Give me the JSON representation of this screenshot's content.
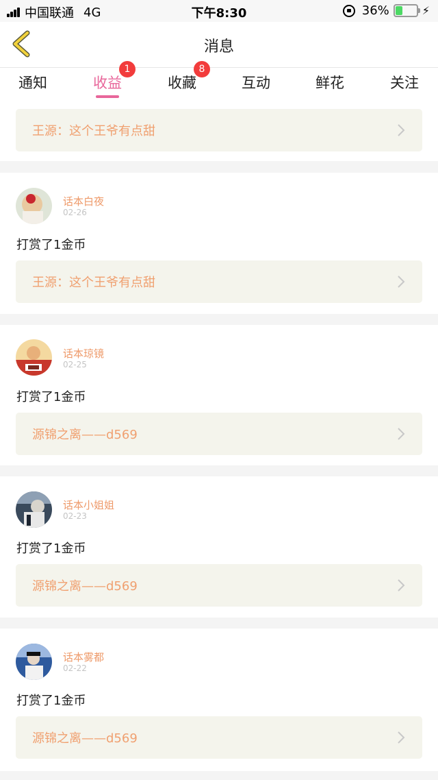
{
  "status_bar": {
    "carrier": "中国联通",
    "network": "4G",
    "time": "下午8:30",
    "battery": "36%",
    "battery_level": 0.36
  },
  "nav": {
    "title": "消息",
    "back_icon": "chevron-left-icon"
  },
  "tabs": [
    {
      "label": "通知",
      "badge": ""
    },
    {
      "label": "收益",
      "badge": "1",
      "active": true
    },
    {
      "label": "收藏",
      "badge": "8"
    },
    {
      "label": "互动",
      "badge": ""
    },
    {
      "label": "鲜花",
      "badge": ""
    },
    {
      "label": "关注",
      "badge": ""
    }
  ],
  "top_card": {
    "quote": "王源：这个王爷有点甜"
  },
  "messages": [
    {
      "name": "话本白夜",
      "date": "02-26",
      "action": "打赏了1金币",
      "quote": "王源：这个王爷有点甜"
    },
    {
      "name": "话本琼镜",
      "date": "02-25",
      "action": "打赏了1金币",
      "quote": "源锦之离——d569"
    },
    {
      "name": "话本小姐姐",
      "date": "02-23",
      "action": "打赏了1金币",
      "quote": "源锦之离——d569"
    },
    {
      "name": "话本雾都",
      "date": "02-22",
      "action": "打赏了1金币",
      "quote": "源锦之离——d569"
    }
  ],
  "colors": {
    "accent": "#e8669a",
    "badge": "#f23c3c",
    "username": "#ee9a6a",
    "quote_bg": "#f4f4ec"
  }
}
